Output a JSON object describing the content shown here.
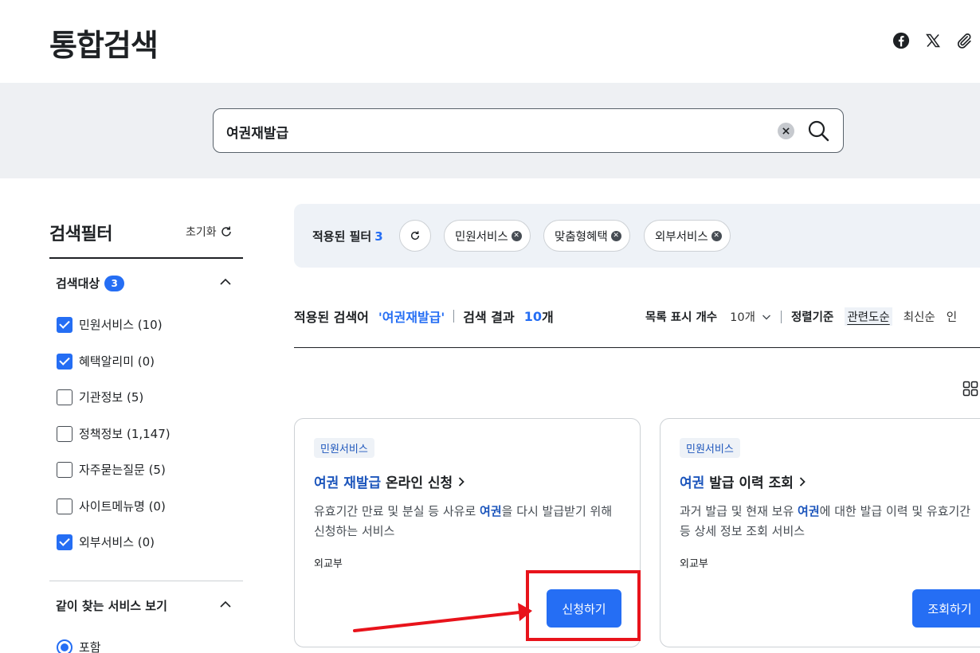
{
  "header": {
    "title": "통합검색",
    "share_icons": [
      "facebook-icon",
      "x-icon",
      "link-icon"
    ]
  },
  "search": {
    "value": "여권재발급"
  },
  "filter": {
    "title": "검색필터",
    "reset_label": "초기화",
    "target_section": {
      "label": "검색대상",
      "count": "3",
      "options": [
        {
          "label": "민원서비스 (10)",
          "checked": true
        },
        {
          "label": "혜택알리미 (0)",
          "checked": true
        },
        {
          "label": "기관정보 (5)",
          "checked": false
        },
        {
          "label": "정책정보 (1,147)",
          "checked": false
        },
        {
          "label": "자주묻는질문 (5)",
          "checked": false
        },
        {
          "label": "사이트메뉴명 (0)",
          "checked": false
        },
        {
          "label": "외부서비스 (0)",
          "checked": true
        }
      ]
    },
    "related_section": {
      "label": "같이 찾는 서비스 보기",
      "radio_label": "포함"
    }
  },
  "applied": {
    "label": "적용된 필터",
    "count": "3",
    "chips": [
      "민원서비스",
      "맞춤형혜택",
      "외부서비스"
    ]
  },
  "summary": {
    "keyword_label": "적용된 검색어",
    "keyword": "'여권재발급'",
    "result_label": "검색 결과",
    "result_count": "10",
    "result_unit": "개"
  },
  "list_options": {
    "count_label": "목록 표시 개수",
    "count_value": "10개",
    "sort_label": "정렬기준",
    "sort_options": [
      "관련도순",
      "최신순",
      "인"
    ]
  },
  "cards": [
    {
      "tag": "민원서비스",
      "title_hl": "여권 재발급",
      "title_rest": " 온라인 신청",
      "desc_pre": "유효기간 만료 및 분실 등 사유로 ",
      "desc_hl": "여권",
      "desc_post": "을 다시 발급받기 위해 신청하는 서비스",
      "org": "외교부",
      "button": "신청하기"
    },
    {
      "tag": "민원서비스",
      "title_hl": "여권",
      "title_rest": " 발급 이력 조회",
      "desc_pre": "과거 발급 및 현재 보유 ",
      "desc_hl": "여권",
      "desc_post": "에 대한 발급 이력 및 유효기간 등 상세 정보 조회 서비스",
      "org": "외교부",
      "button": "조회하기"
    }
  ],
  "colors": {
    "primary": "#256ef4",
    "highlight_text": "#1d56bc",
    "annotation_red": "#e8131b"
  }
}
